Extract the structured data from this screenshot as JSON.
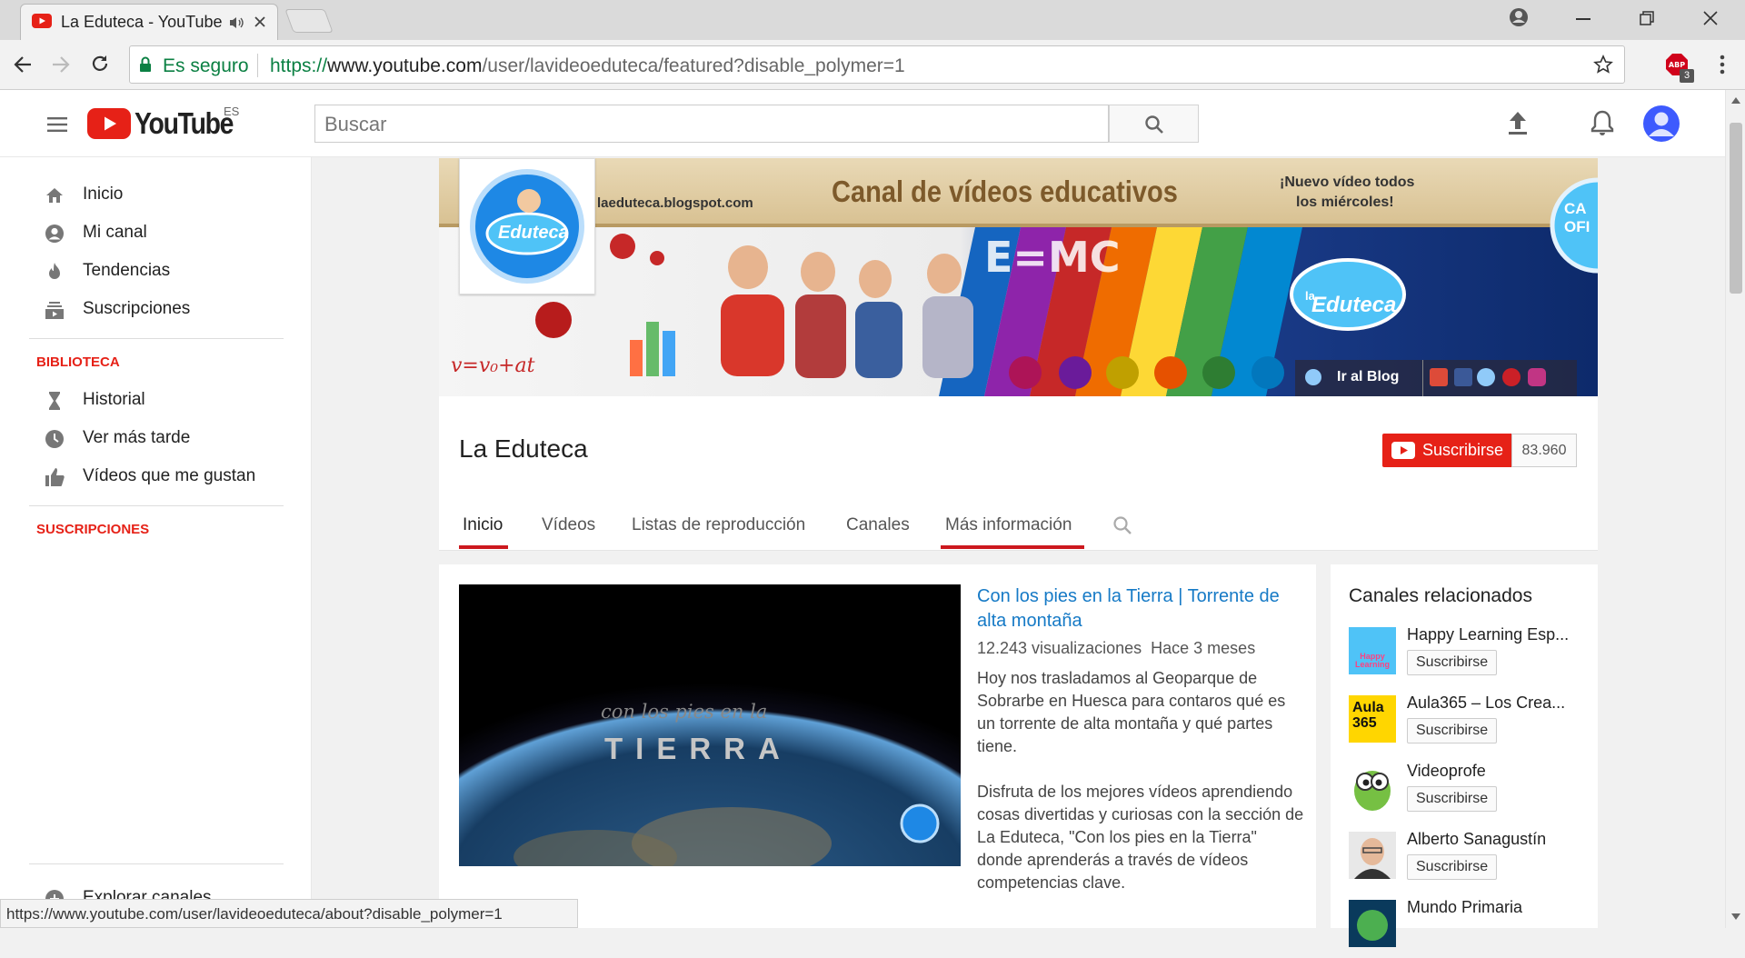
{
  "browser": {
    "tab_title": "La Eduteca - YouTube",
    "secure_label": "Es seguro",
    "url_scheme": "https://",
    "url_host": "www.youtube.com",
    "url_path": "/user/lavideoeduteca/featured?disable_polymer=1",
    "ext_badge": "3",
    "status_url": "https://www.youtube.com/user/lavideoeduteca/about?disable_polymer=1"
  },
  "header": {
    "logo_text": "YouTube",
    "region": "ES",
    "search_placeholder": "Buscar"
  },
  "sidebar": {
    "items": [
      {
        "label": "Inicio",
        "icon": "home-icon"
      },
      {
        "label": "Mi canal",
        "icon": "account-icon"
      },
      {
        "label": "Tendencias",
        "icon": "flame-icon"
      },
      {
        "label": "Suscripciones",
        "icon": "subscriptions-icon"
      }
    ],
    "library_heading": "BIBLIOTECA",
    "library": [
      {
        "label": "Historial",
        "icon": "hourglass-icon"
      },
      {
        "label": "Ver más tarde",
        "icon": "clock-icon"
      },
      {
        "label": "Vídeos que me gustan",
        "icon": "thumbs-up-icon"
      }
    ],
    "subs_heading": "SUSCRIPCIONES",
    "explore_label": "Explorar canales"
  },
  "banner": {
    "site": "laeduteca.blogspot.com",
    "headline": "Canal de vídeos educativos",
    "promo_line1": "¡Nuevo vídeo todos",
    "promo_line2": "los miércoles!",
    "blog_link": "Ir al Blog",
    "logo_word": "Eduteca",
    "logo_prefix": "la",
    "corner_text": "CA OFI"
  },
  "channel": {
    "title": "La Eduteca",
    "subscribe_label": "Suscribirse",
    "subscriber_count": "83.960",
    "tabs": [
      "Inicio",
      "Vídeos",
      "Listas de reproducción",
      "Canales",
      "Más información"
    ]
  },
  "featured": {
    "title": "Con los pies en la Tierra | Torrente de alta montaña",
    "views": "12.243 visualizaciones",
    "age": "Hace 3 meses",
    "desc_p1": "Hoy nos trasladamos al Geoparque de Sobrarbe en Huesca para contaros qué es un torrente de alta montaña y qué partes tiene.",
    "desc_p2": "Disfruta de los mejores vídeos aprendiendo cosas divertidas y curiosas con la sección de La Eduteca, \"Con los pies en la Tierra\" donde aprenderás a través de vídeos competencias clave.",
    "thumb_script": "con los pies en la",
    "thumb_word": "TIERRA"
  },
  "related": {
    "title": "Canales relacionados",
    "subscribe_label": "Suscribirse",
    "channels": [
      {
        "name": "Happy Learning Esp...",
        "thumb_text": "Happy Learning"
      },
      {
        "name": "Aula365 – Los Crea...",
        "thumb_text": "Aula 365"
      },
      {
        "name": "Videoprofe"
      },
      {
        "name": "Alberto Sanagustín"
      },
      {
        "name": "Mundo Primaria"
      }
    ]
  },
  "colors": {
    "youtube_red": "#e62117",
    "link_blue": "#167ac6",
    "secure_green": "#0b8043"
  }
}
